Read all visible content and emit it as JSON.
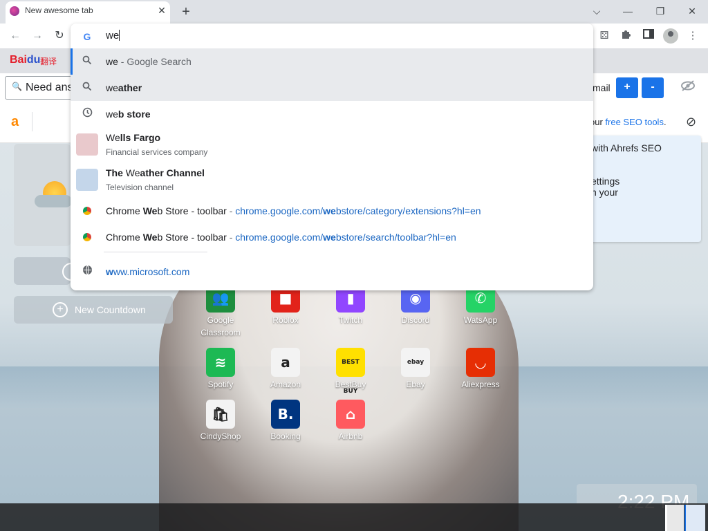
{
  "tab": {
    "title": "New awesome tab",
    "close": "✕",
    "new_tab": "+"
  },
  "window": {
    "min": "⌵",
    "restore": "❐",
    "close": "✕"
  },
  "nav": {
    "back": "←",
    "forward": "→",
    "reload": "↻"
  },
  "omnibox": {
    "engine_icon": "G",
    "query": "we"
  },
  "suggestions": [
    {
      "icon": "search-icon",
      "text": "we",
      "suffix": " - Google Search"
    },
    {
      "icon": "search-icon",
      "prefix": "we",
      "bold": "ather"
    },
    {
      "icon": "history-icon",
      "prefix": "we",
      "bold": "b store"
    },
    {
      "icon": "entity-thumbnail",
      "prefix": "We",
      "bold": "lls Fargo",
      "sub": "Financial services company",
      "thumb_color": "#e9c9cc"
    },
    {
      "icon": "entity-thumbnail",
      "bold_lead": "The ",
      "mid": "We",
      "bold": "ather Channel",
      "sub": "Television channel",
      "thumb_color": "#c4d6ea"
    },
    {
      "icon": "chrome-web-store-icon",
      "pre": "Chrome ",
      "bold": "We",
      "post": "b Store - toolbar",
      "sep": " - ",
      "url_a": "chrome.google.com/",
      "url_b": "we",
      "url_c": "bstore/category/extensions?hl=en"
    },
    {
      "icon": "chrome-web-store-icon",
      "pre": "Chrome ",
      "bold": "We",
      "post": "b Store - toolbar",
      "sep": " - ",
      "url_a": "chrome.google.com/",
      "url_b": "we",
      "url_c": "bstore/search/toolbar?hl=en"
    },
    {
      "icon": "globe-icon",
      "url_b": "w",
      "url_c": "ww.microsoft.com"
    }
  ],
  "bookmarks": {
    "baidu_a": "Bai",
    "baidu_b": "du",
    "fanyi": "翻译"
  },
  "extension_bar": {
    "search_icon": "🔍",
    "need_text": "Need ans",
    "mail": "mail",
    "plus": "+",
    "minus": "-"
  },
  "ahrefs": {
    "logo": "a",
    "tagline_pre": "our ",
    "tagline_link": "free SEO tools",
    "tagline_post": ".",
    "panel_lines": [
      "with Ahrefs SEO",
      "",
      "ettings",
      "n your"
    ]
  },
  "widgets": {
    "countdown_label": "New Countdown"
  },
  "apps": [
    {
      "name": "Google Classroom",
      "label_a": "Google",
      "label_b": "Classroom",
      "color": "#1e8e3e",
      "glyph": "👥"
    },
    {
      "name": "Roblox",
      "label_a": "Roblox",
      "color": "#e2231a",
      "glyph": "■"
    },
    {
      "name": "Twitch",
      "label_a": "Twitch",
      "color": "#9146ff",
      "glyph": "▮"
    },
    {
      "name": "Discord",
      "label_a": "Discord",
      "color": "#5865f2",
      "glyph": "◉"
    },
    {
      "name": "WatsApp",
      "label_a": "WatsApp",
      "color": "#25d366",
      "glyph": "✆"
    },
    {
      "name": "Spotify",
      "label_a": "Spotify",
      "color": "#1db954",
      "glyph": "≋"
    },
    {
      "name": "Amazon",
      "label_a": "Amazon",
      "color": "#f3f3f3",
      "glyph": "a"
    },
    {
      "name": "BestBuy",
      "label_a": "BestBuy",
      "color": "#ffe000",
      "glyph": "BEST BUY"
    },
    {
      "name": "Ebay",
      "label_a": "Ebay",
      "color": "#f3f3f3",
      "glyph": "ebay"
    },
    {
      "name": "Aliexpress",
      "label_a": "Aliexpress",
      "color": "#e62e04",
      "glyph": "◡"
    },
    {
      "name": "CindyShop",
      "label_a": "CindyShop",
      "color": "#f3f3f3",
      "glyph": "🛍"
    },
    {
      "name": "Booking",
      "label_a": "Booking",
      "color": "#003580",
      "glyph": "B."
    },
    {
      "name": "Airbnb",
      "label_a": "Airbnb",
      "color": "#ff5a5f",
      "glyph": "⌂"
    }
  ],
  "clock": {
    "time": "2:22 PM"
  }
}
